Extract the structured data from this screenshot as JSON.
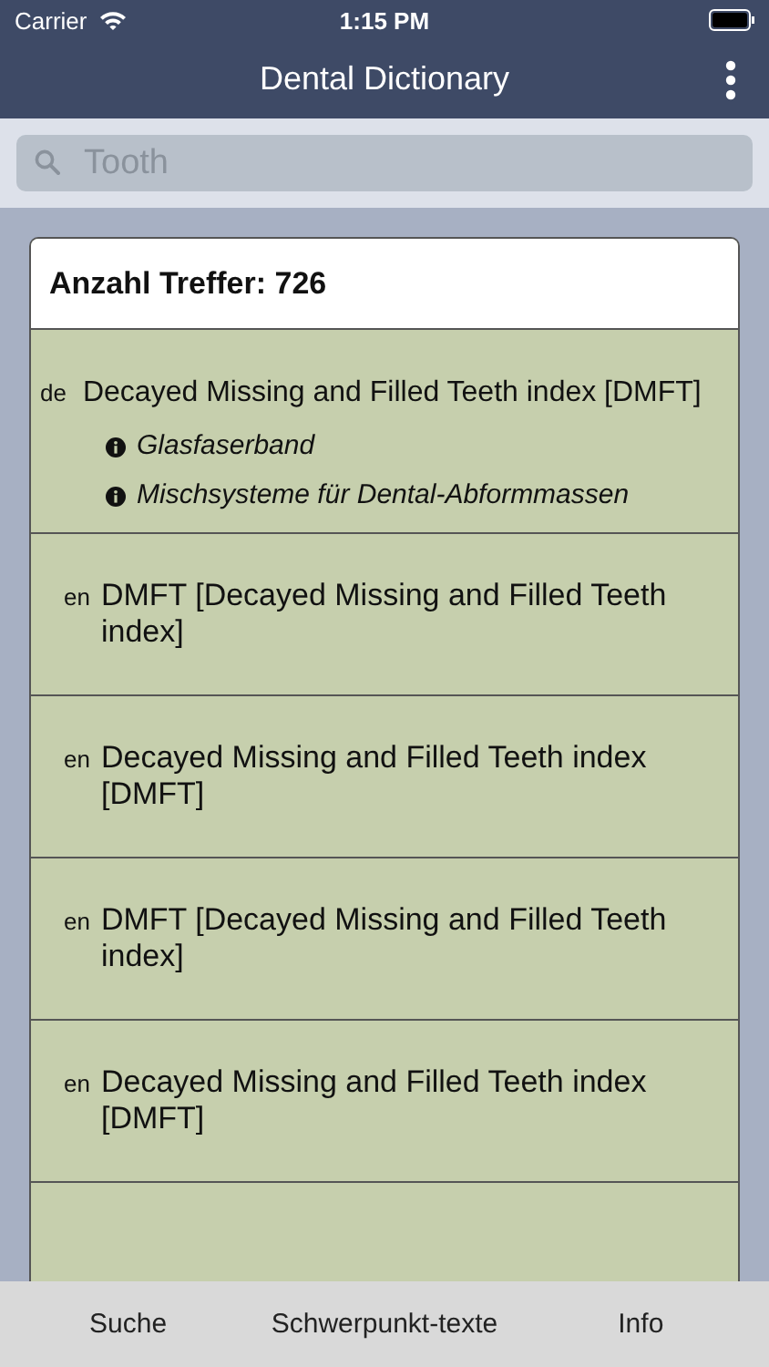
{
  "status_bar": {
    "carrier": "Carrier",
    "time": "1:15 PM"
  },
  "nav": {
    "title": "Dental Dictionary"
  },
  "search": {
    "placeholder": "Tooth"
  },
  "results": {
    "count_label": "Anzahl Treffer: 726",
    "rows": [
      {
        "kind": "entry",
        "lang": "de",
        "term": "Decayed Missing and Filled Teeth index [DMFT]",
        "refs": [
          "Glasfaserband",
          "Mischsysteme für Dental-Abformmassen"
        ]
      },
      {
        "kind": "translation",
        "lang": "en",
        "term": "DMFT [Decayed Missing and Filled Teeth index]"
      },
      {
        "kind": "translation",
        "lang": "en",
        "term": "Decayed Missing and Filled Teeth index [DMFT]"
      },
      {
        "kind": "translation",
        "lang": "en",
        "term": "DMFT [Decayed Missing and Filled Teeth index]"
      },
      {
        "kind": "translation",
        "lang": "en",
        "term": "Decayed Missing and Filled Teeth index [DMFT]"
      }
    ]
  },
  "tab_bar": [
    {
      "label": "Suche",
      "selected": false
    },
    {
      "label": "Schwerpunkt-texte",
      "selected": false
    },
    {
      "label": "Info",
      "selected": false
    }
  ]
}
